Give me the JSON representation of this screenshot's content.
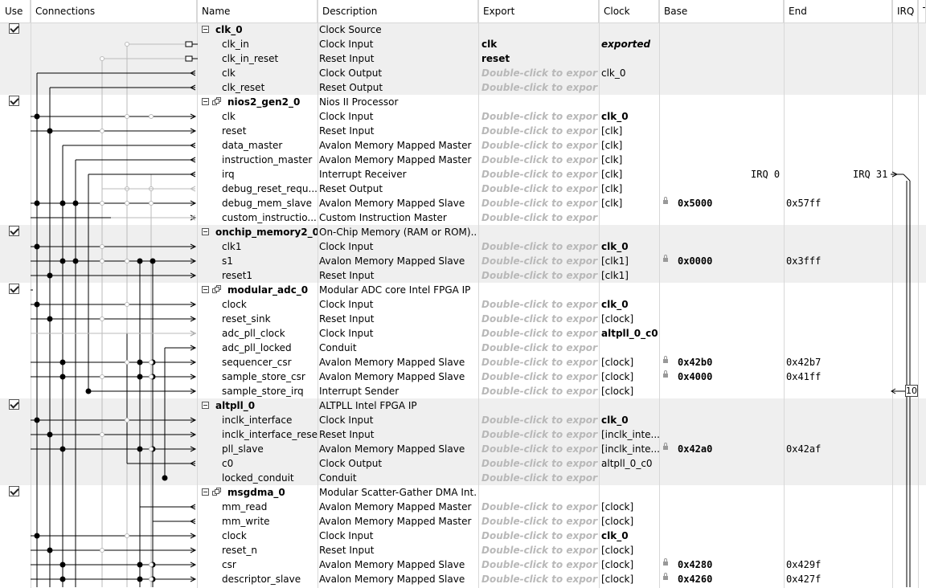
{
  "header": {
    "columns": [
      {
        "key": "use",
        "label": "Use"
      },
      {
        "key": "connections",
        "label": "Connections"
      },
      {
        "key": "name",
        "label": "Name"
      },
      {
        "key": "description",
        "label": "Description"
      },
      {
        "key": "export",
        "label": "Export"
      },
      {
        "key": "clock",
        "label": "Clock"
      },
      {
        "key": "base",
        "label": "Base"
      },
      {
        "key": "end",
        "label": "End"
      },
      {
        "key": "irq",
        "label": "IRQ"
      },
      {
        "key": "tags",
        "label": "T"
      }
    ]
  },
  "placeholder_export": "Double-click to export",
  "rows": [
    {
      "type": "component",
      "name": "clk_0",
      "desc": "Clock Source",
      "checked": true,
      "hier": false
    },
    {
      "type": "iface",
      "name": "clk_in",
      "desc": "Clock Input",
      "export": "clk",
      "exportStyle": "real"
    },
    {
      "type": "iface",
      "name": "clk_in_reset",
      "desc": "Reset Input",
      "export": "reset",
      "exportStyle": "real"
    },
    {
      "type": "iface",
      "name": "clk",
      "desc": "Clock Output",
      "export": "",
      "clock": "clk_0"
    },
    {
      "type": "iface",
      "name": "clk_reset",
      "desc": "Reset Output",
      "export": ""
    },
    {
      "type": "component",
      "name": "nios2_gen2_0",
      "desc": "Nios II Processor",
      "checked": true,
      "hier": true
    },
    {
      "type": "iface",
      "name": "clk",
      "desc": "Clock Input",
      "export": "",
      "clock": "clk_0",
      "clockBold": true
    },
    {
      "type": "iface",
      "name": "reset",
      "desc": "Reset Input",
      "export": "",
      "clock": "[clk]"
    },
    {
      "type": "iface",
      "name": "data_master",
      "desc": "Avalon Memory Mapped Master",
      "export": "",
      "clock": "[clk]"
    },
    {
      "type": "iface",
      "name": "instruction_master",
      "desc": "Avalon Memory Mapped Master",
      "export": "",
      "clock": "[clk]"
    },
    {
      "type": "iface",
      "name": "irq",
      "desc": "Interrupt Receiver",
      "export": "",
      "clock": "[clk]",
      "irqLeft": "IRQ 0",
      "irqRight": "IRQ 31"
    },
    {
      "type": "iface",
      "name": "debug_reset_requ...",
      "desc": "Reset Output",
      "export": "",
      "clock": "[clk]"
    },
    {
      "type": "iface",
      "name": "debug_mem_slave",
      "desc": "Avalon Memory Mapped Slave",
      "export": "",
      "clock": "[clk]",
      "base": "0x5000",
      "end": "0x57ff"
    },
    {
      "type": "iface",
      "name": "custom_instructio...",
      "desc": "Custom Instruction Master",
      "export": ""
    },
    {
      "type": "component",
      "name": "onchip_memory2_0",
      "desc": "On-Chip Memory (RAM or ROM)...",
      "checked": true,
      "hier": false
    },
    {
      "type": "iface",
      "name": "clk1",
      "desc": "Clock Input",
      "export": "",
      "clock": "clk_0",
      "clockBold": true
    },
    {
      "type": "iface",
      "name": "s1",
      "desc": "Avalon Memory Mapped Slave",
      "export": "",
      "clock": "[clk1]",
      "base": "0x0000",
      "end": "0x3fff"
    },
    {
      "type": "iface",
      "name": "reset1",
      "desc": "Reset Input",
      "export": "",
      "clock": "[clk1]"
    },
    {
      "type": "component",
      "name": "modular_adc_0",
      "desc": "Modular ADC core Intel FPGA IP",
      "checked": true,
      "hier": true
    },
    {
      "type": "iface",
      "name": "clock",
      "desc": "Clock Input",
      "export": "",
      "clock": "clk_0",
      "clockBold": true
    },
    {
      "type": "iface",
      "name": "reset_sink",
      "desc": "Reset Input",
      "export": "",
      "clock": "[clock]"
    },
    {
      "type": "iface",
      "name": "adc_pll_clock",
      "desc": "Clock Input",
      "export": "",
      "clock": "altpll_0_c0",
      "clockBold": true
    },
    {
      "type": "iface",
      "name": "adc_pll_locked",
      "desc": "Conduit",
      "export": ""
    },
    {
      "type": "iface",
      "name": "sequencer_csr",
      "desc": "Avalon Memory Mapped Slave",
      "export": "",
      "clock": "[clock]",
      "base": "0x42b0",
      "end": "0x42b7"
    },
    {
      "type": "iface",
      "name": "sample_store_csr",
      "desc": "Avalon Memory Mapped Slave",
      "export": "",
      "clock": "[clock]",
      "base": "0x4000",
      "end": "0x41ff"
    },
    {
      "type": "iface",
      "name": "sample_store_irq",
      "desc": "Interrupt Sender",
      "export": "",
      "clock": "[clock]",
      "irqNum": "10"
    },
    {
      "type": "component",
      "name": "altpll_0",
      "desc": "ALTPLL Intel FPGA IP",
      "checked": true,
      "hier": false
    },
    {
      "type": "iface",
      "name": "inclk_interface",
      "desc": "Clock Input",
      "export": "",
      "clock": "clk_0",
      "clockBold": true
    },
    {
      "type": "iface",
      "name": "inclk_interface_reset",
      "desc": "Reset Input",
      "export": "",
      "clock": "[inclk_inte..."
    },
    {
      "type": "iface",
      "name": "pll_slave",
      "desc": "Avalon Memory Mapped Slave",
      "export": "",
      "clock": "[inclk_inte...",
      "base": "0x42a0",
      "end": "0x42af"
    },
    {
      "type": "iface",
      "name": "c0",
      "desc": "Clock Output",
      "export": "",
      "clock": "altpll_0_c0"
    },
    {
      "type": "iface",
      "name": "locked_conduit",
      "desc": "Conduit",
      "export": ""
    },
    {
      "type": "component",
      "name": "msgdma_0",
      "desc": "Modular Scatter-Gather DMA Int...",
      "checked": true,
      "hier": true
    },
    {
      "type": "iface",
      "name": "mm_read",
      "desc": "Avalon Memory Mapped Master",
      "export": "",
      "clock": "[clock]"
    },
    {
      "type": "iface",
      "name": "mm_write",
      "desc": "Avalon Memory Mapped Master",
      "export": "",
      "clock": "[clock]"
    },
    {
      "type": "iface",
      "name": "clock",
      "desc": "Clock Input",
      "export": "",
      "clock": "clk_0",
      "clockBold": true
    },
    {
      "type": "iface",
      "name": "reset_n",
      "desc": "Reset Input",
      "export": "",
      "clock": "[clock]"
    },
    {
      "type": "iface",
      "name": "csr",
      "desc": "Avalon Memory Mapped Slave",
      "export": "",
      "clock": "[clock]",
      "base": "0x4280",
      "end": "0x429f"
    },
    {
      "type": "iface",
      "name": "descriptor_slave",
      "desc": "Avalon Memory Mapped Slave",
      "export": "",
      "clock": "[clock]",
      "base": "0x4260",
      "end": "0x427f"
    }
  ],
  "row3_clock_override": {
    "3": "clk_0",
    "1": "exported"
  }
}
